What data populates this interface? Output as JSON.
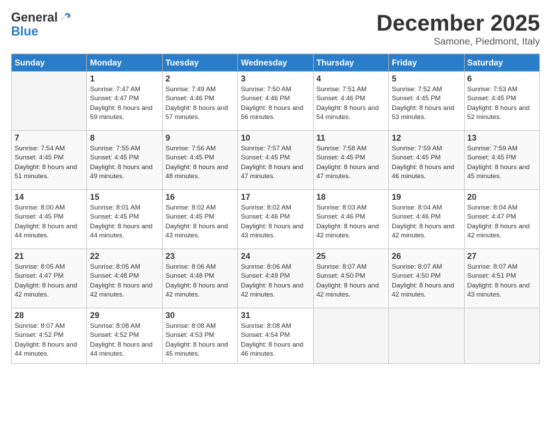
{
  "logo": {
    "general": "General",
    "blue": "Blue"
  },
  "title": {
    "month_year": "December 2025",
    "location": "Samone, Piedmont, Italy"
  },
  "days_of_week": [
    "Sunday",
    "Monday",
    "Tuesday",
    "Wednesday",
    "Thursday",
    "Friday",
    "Saturday"
  ],
  "weeks": [
    [
      {
        "num": "",
        "sunrise": "",
        "sunset": "",
        "daylight": ""
      },
      {
        "num": "1",
        "sunrise": "Sunrise: 7:47 AM",
        "sunset": "Sunset: 4:47 PM",
        "daylight": "Daylight: 8 hours and 59 minutes."
      },
      {
        "num": "2",
        "sunrise": "Sunrise: 7:49 AM",
        "sunset": "Sunset: 4:46 PM",
        "daylight": "Daylight: 8 hours and 57 minutes."
      },
      {
        "num": "3",
        "sunrise": "Sunrise: 7:50 AM",
        "sunset": "Sunset: 4:46 PM",
        "daylight": "Daylight: 8 hours and 56 minutes."
      },
      {
        "num": "4",
        "sunrise": "Sunrise: 7:51 AM",
        "sunset": "Sunset: 4:46 PM",
        "daylight": "Daylight: 8 hours and 54 minutes."
      },
      {
        "num": "5",
        "sunrise": "Sunrise: 7:52 AM",
        "sunset": "Sunset: 4:45 PM",
        "daylight": "Daylight: 8 hours and 53 minutes."
      },
      {
        "num": "6",
        "sunrise": "Sunrise: 7:53 AM",
        "sunset": "Sunset: 4:45 PM",
        "daylight": "Daylight: 8 hours and 52 minutes."
      }
    ],
    [
      {
        "num": "7",
        "sunrise": "Sunrise: 7:54 AM",
        "sunset": "Sunset: 4:45 PM",
        "daylight": "Daylight: 8 hours and 51 minutes."
      },
      {
        "num": "8",
        "sunrise": "Sunrise: 7:55 AM",
        "sunset": "Sunset: 4:45 PM",
        "daylight": "Daylight: 8 hours and 49 minutes."
      },
      {
        "num": "9",
        "sunrise": "Sunrise: 7:56 AM",
        "sunset": "Sunset: 4:45 PM",
        "daylight": "Daylight: 8 hours and 48 minutes."
      },
      {
        "num": "10",
        "sunrise": "Sunrise: 7:57 AM",
        "sunset": "Sunset: 4:45 PM",
        "daylight": "Daylight: 8 hours and 47 minutes."
      },
      {
        "num": "11",
        "sunrise": "Sunrise: 7:58 AM",
        "sunset": "Sunset: 4:45 PM",
        "daylight": "Daylight: 8 hours and 47 minutes."
      },
      {
        "num": "12",
        "sunrise": "Sunrise: 7:59 AM",
        "sunset": "Sunset: 4:45 PM",
        "daylight": "Daylight: 8 hours and 46 minutes."
      },
      {
        "num": "13",
        "sunrise": "Sunrise: 7:59 AM",
        "sunset": "Sunset: 4:45 PM",
        "daylight": "Daylight: 8 hours and 45 minutes."
      }
    ],
    [
      {
        "num": "14",
        "sunrise": "Sunrise: 8:00 AM",
        "sunset": "Sunset: 4:45 PM",
        "daylight": "Daylight: 8 hours and 44 minutes."
      },
      {
        "num": "15",
        "sunrise": "Sunrise: 8:01 AM",
        "sunset": "Sunset: 4:45 PM",
        "daylight": "Daylight: 8 hours and 44 minutes."
      },
      {
        "num": "16",
        "sunrise": "Sunrise: 8:02 AM",
        "sunset": "Sunset: 4:45 PM",
        "daylight": "Daylight: 8 hours and 43 minutes."
      },
      {
        "num": "17",
        "sunrise": "Sunrise: 8:02 AM",
        "sunset": "Sunset: 4:46 PM",
        "daylight": "Daylight: 8 hours and 43 minutes."
      },
      {
        "num": "18",
        "sunrise": "Sunrise: 8:03 AM",
        "sunset": "Sunset: 4:46 PM",
        "daylight": "Daylight: 8 hours and 42 minutes."
      },
      {
        "num": "19",
        "sunrise": "Sunrise: 8:04 AM",
        "sunset": "Sunset: 4:46 PM",
        "daylight": "Daylight: 8 hours and 42 minutes."
      },
      {
        "num": "20",
        "sunrise": "Sunrise: 8:04 AM",
        "sunset": "Sunset: 4:47 PM",
        "daylight": "Daylight: 8 hours and 42 minutes."
      }
    ],
    [
      {
        "num": "21",
        "sunrise": "Sunrise: 8:05 AM",
        "sunset": "Sunset: 4:47 PM",
        "daylight": "Daylight: 8 hours and 42 minutes."
      },
      {
        "num": "22",
        "sunrise": "Sunrise: 8:05 AM",
        "sunset": "Sunset: 4:48 PM",
        "daylight": "Daylight: 8 hours and 42 minutes."
      },
      {
        "num": "23",
        "sunrise": "Sunrise: 8:06 AM",
        "sunset": "Sunset: 4:48 PM",
        "daylight": "Daylight: 8 hours and 42 minutes."
      },
      {
        "num": "24",
        "sunrise": "Sunrise: 8:06 AM",
        "sunset": "Sunset: 4:49 PM",
        "daylight": "Daylight: 8 hours and 42 minutes."
      },
      {
        "num": "25",
        "sunrise": "Sunrise: 8:07 AM",
        "sunset": "Sunset: 4:50 PM",
        "daylight": "Daylight: 8 hours and 42 minutes."
      },
      {
        "num": "26",
        "sunrise": "Sunrise: 8:07 AM",
        "sunset": "Sunset: 4:50 PM",
        "daylight": "Daylight: 8 hours and 42 minutes."
      },
      {
        "num": "27",
        "sunrise": "Sunrise: 8:07 AM",
        "sunset": "Sunset: 4:51 PM",
        "daylight": "Daylight: 8 hours and 43 minutes."
      }
    ],
    [
      {
        "num": "28",
        "sunrise": "Sunrise: 8:07 AM",
        "sunset": "Sunset: 4:52 PM",
        "daylight": "Daylight: 8 hours and 44 minutes."
      },
      {
        "num": "29",
        "sunrise": "Sunrise: 8:08 AM",
        "sunset": "Sunset: 4:52 PM",
        "daylight": "Daylight: 8 hours and 44 minutes."
      },
      {
        "num": "30",
        "sunrise": "Sunrise: 8:08 AM",
        "sunset": "Sunset: 4:53 PM",
        "daylight": "Daylight: 8 hours and 45 minutes."
      },
      {
        "num": "31",
        "sunrise": "Sunrise: 8:08 AM",
        "sunset": "Sunset: 4:54 PM",
        "daylight": "Daylight: 8 hours and 46 minutes."
      },
      {
        "num": "",
        "sunrise": "",
        "sunset": "",
        "daylight": ""
      },
      {
        "num": "",
        "sunrise": "",
        "sunset": "",
        "daylight": ""
      },
      {
        "num": "",
        "sunrise": "",
        "sunset": "",
        "daylight": ""
      }
    ]
  ]
}
